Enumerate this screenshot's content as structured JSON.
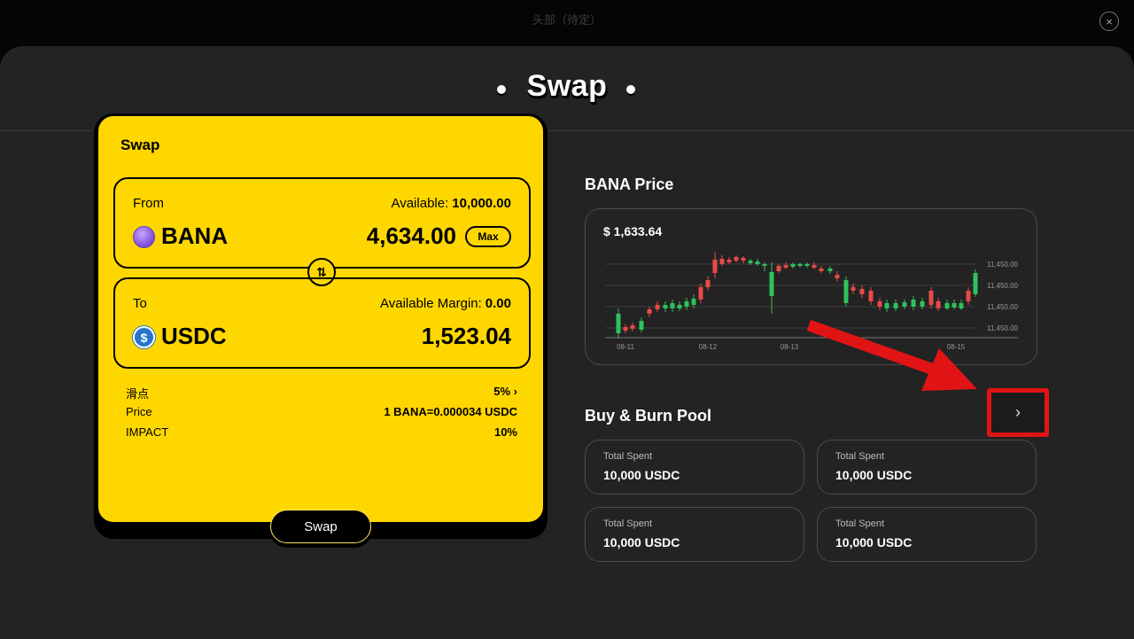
{
  "topbar": {
    "title": "头部（待定）",
    "close_icon": "×"
  },
  "page": {
    "title": "Swap"
  },
  "swap_card": {
    "title": "Swap",
    "from": {
      "label": "From",
      "available_label": "Available:",
      "available_value": "10,000.00",
      "token": "BANA",
      "amount": "4,634.00",
      "max_label": "Max"
    },
    "to": {
      "label": "To",
      "available_label": "Available Margin:",
      "available_value": "0.00",
      "token": "USDC",
      "amount": "1,523.04",
      "icon_glyph": "$"
    },
    "switch_icon": "⇅",
    "info": [
      {
        "label": "滑点",
        "value": "5% ›"
      },
      {
        "label": "Price",
        "value": "1 BANA=0.000034 USDC"
      },
      {
        "label": "IMPACT",
        "value": "10%"
      }
    ],
    "submit_label": "Swap"
  },
  "price": {
    "title": "BANA Price",
    "value": "$ 1,633.64",
    "y_ticks": [
      "11,450.00",
      "11,450.00",
      "11,450.00",
      "11,450.00"
    ],
    "x_ticks": [
      "08-11",
      "08-12",
      "08-13",
      "08-15"
    ]
  },
  "pool": {
    "title": "Buy & Burn Pool",
    "chevron": "›",
    "cards": [
      {
        "label": "Total Spent",
        "value": "10,000 USDC"
      },
      {
        "label": "Total Spent",
        "value": "10,000 USDC"
      },
      {
        "label": "Total Spent",
        "value": "10,000 USDC"
      },
      {
        "label": "Total Spent",
        "value": "10,000 USDC"
      }
    ]
  },
  "colors": {
    "accent_yellow": "#ffd700",
    "up": "#2fc25b",
    "down": "#e84a4a",
    "annotation": "#e01414"
  }
}
